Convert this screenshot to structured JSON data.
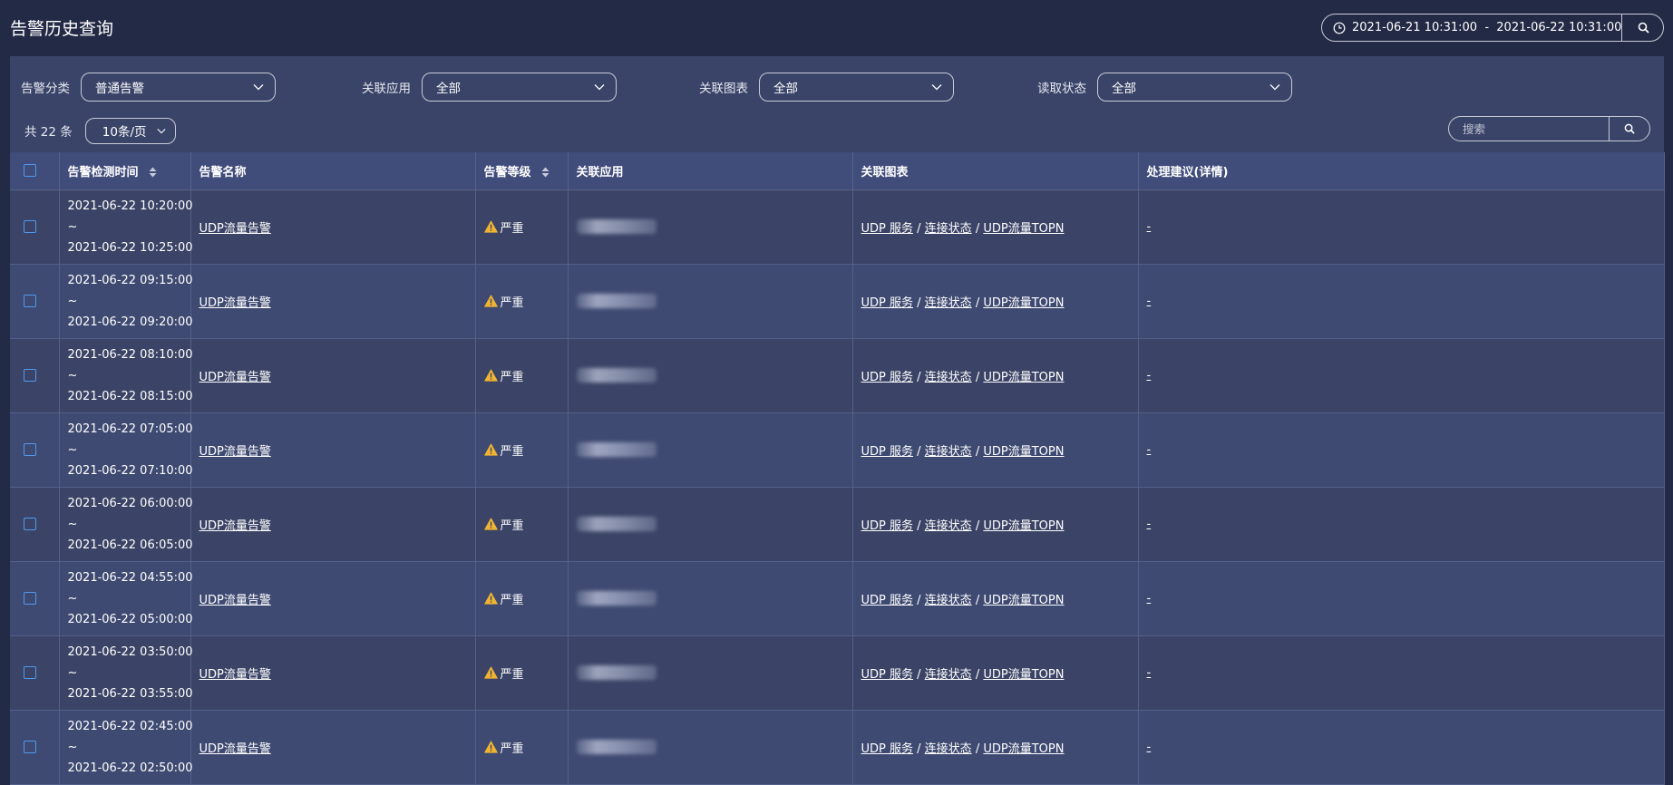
{
  "header": {
    "title": "告警历史查询",
    "date_range": "2021-06-21 10:31:00  -  2021-06-22 10:31:00"
  },
  "filters": [
    {
      "label": "告警分类",
      "value": "普通告警"
    },
    {
      "label": "关联应用",
      "value": "全部"
    },
    {
      "label": "关联图表",
      "value": "全部"
    },
    {
      "label": "读取状态",
      "value": "全部"
    }
  ],
  "pagination": {
    "total_text": "共 22 条",
    "page_size": "10条/页"
  },
  "search": {
    "placeholder": "搜索"
  },
  "table": {
    "columns": [
      "告警检测时间",
      "告警名称",
      "告警等级",
      "关联应用",
      "关联图表",
      "处理建议(详情)"
    ],
    "rows": [
      {
        "start": "2021-06-22 10:20:00",
        "tilde": "~",
        "end": "2021-06-22 10:25:00",
        "name": "UDP流量告警",
        "level": "严重",
        "chart1": "UDP 服务",
        "chart2": "连接状态",
        "chart3": "UDP流量TOPN",
        "suggestion": "-"
      },
      {
        "start": "2021-06-22 09:15:00",
        "tilde": "~",
        "end": "2021-06-22 09:20:00",
        "name": "UDP流量告警",
        "level": "严重",
        "chart1": "UDP 服务",
        "chart2": "连接状态",
        "chart3": "UDP流量TOPN",
        "suggestion": "-"
      },
      {
        "start": "2021-06-22 08:10:00",
        "tilde": "~",
        "end": "2021-06-22 08:15:00",
        "name": "UDP流量告警",
        "level": "严重",
        "chart1": "UDP 服务",
        "chart2": "连接状态",
        "chart3": "UDP流量TOPN",
        "suggestion": "-"
      },
      {
        "start": "2021-06-22 07:05:00",
        "tilde": "~",
        "end": "2021-06-22 07:10:00",
        "name": "UDP流量告警",
        "level": "严重",
        "chart1": "UDP 服务",
        "chart2": "连接状态",
        "chart3": "UDP流量TOPN",
        "suggestion": "-"
      },
      {
        "start": "2021-06-22 06:00:00",
        "tilde": "~",
        "end": "2021-06-22 06:05:00",
        "name": "UDP流量告警",
        "level": "严重",
        "chart1": "UDP 服务",
        "chart2": "连接状态",
        "chart3": "UDP流量TOPN",
        "suggestion": "-"
      },
      {
        "start": "2021-06-22 04:55:00",
        "tilde": "~",
        "end": "2021-06-22 05:00:00",
        "name": "UDP流量告警",
        "level": "严重",
        "chart1": "UDP 服务",
        "chart2": "连接状态",
        "chart3": "UDP流量TOPN",
        "suggestion": "-"
      },
      {
        "start": "2021-06-22 03:50:00",
        "tilde": "~",
        "end": "2021-06-22 03:55:00",
        "name": "UDP流量告警",
        "level": "严重",
        "chart1": "UDP 服务",
        "chart2": "连接状态",
        "chart3": "UDP流量TOPN",
        "suggestion": "-"
      },
      {
        "start": "2021-06-22 02:45:00",
        "tilde": "~",
        "end": "2021-06-22 02:50:00",
        "name": "UDP流量告警",
        "level": "严重",
        "chart1": "UDP 服务",
        "chart2": "连接状态",
        "chart3": "UDP流量TOPN",
        "suggestion": "-"
      }
    ]
  },
  "colors": {
    "page_bg": "#232a46",
    "panel_bg": "#3a4468",
    "header_row_bg": "#404c7a",
    "checkbox_border": "#4d9af0",
    "warning": "#f0b432"
  },
  "icons": {
    "date_range": "clock-icon",
    "date_search": "search-icon",
    "select": "chevron-down-icon",
    "sort": "sort-icon",
    "level": "warning-icon",
    "table_search": "search-icon"
  }
}
